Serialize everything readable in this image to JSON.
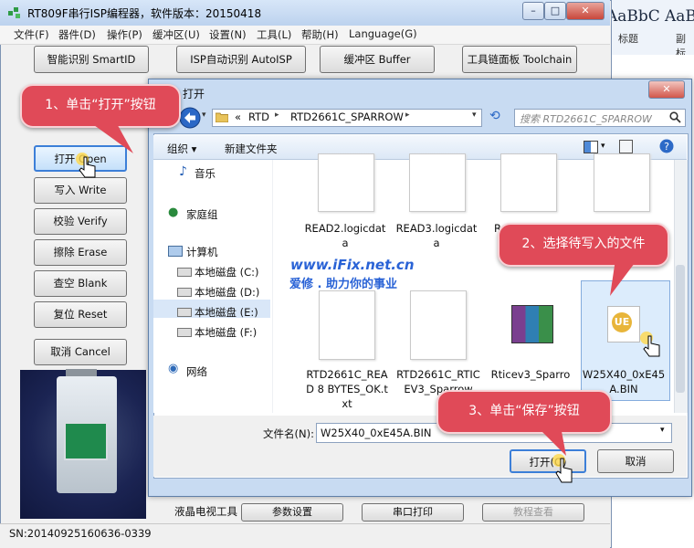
{
  "word": {
    "style1": "AaBbC",
    "style2": "AaBb",
    "cap1": "标题",
    "cap2": "副标"
  },
  "window": {
    "title": "RT809F串行ISP编程器，软件版本：20150418",
    "menu": [
      "文件(F)",
      "器件(D)",
      "操作(P)",
      "缓冲区(U)",
      "设置(N)",
      "工具(L)",
      "帮助(H)",
      "Language(G)"
    ],
    "top_buttons": [
      "智能识别 SmartID",
      "ISP自动识别 AutoISP",
      "缓冲区 Buffer",
      "工具链面板 Toolchain"
    ],
    "side_buttons": [
      "打开 Open",
      "写入 Write",
      "校验 Verify",
      "擦除 Erase",
      "查空 Blank",
      "复位 Reset",
      "取消 Cancel"
    ],
    "bottom_tools": {
      "label": "液晶电视工具",
      "buttons": [
        "参数设置",
        "串口打印",
        "教程查看"
      ]
    },
    "status": "SN:20140925160636-0339"
  },
  "dialog": {
    "title": "打开",
    "address": {
      "prefix": "«",
      "crumbs": [
        "RTD",
        "RTD2661C_SPARROW"
      ]
    },
    "search_placeholder": "搜索 RTD2661C_SPARROW",
    "toolbar": {
      "organize": "组织 ▾",
      "new_folder": "新建文件夹"
    },
    "nav": [
      {
        "label": "音乐",
        "icon": "music-icon"
      },
      {
        "label": "家庭组",
        "icon": "homegroup-icon"
      },
      {
        "label": "计算机",
        "icon": "computer-icon"
      },
      {
        "label": "本地磁盘 (C:)",
        "icon": "drive-icon"
      },
      {
        "label": "本地磁盘 (D:)",
        "icon": "drive-icon"
      },
      {
        "label": "本地磁盘 (E:)",
        "icon": "drive-icon"
      },
      {
        "label": "本地磁盘 (F:)",
        "icon": "drive-icon"
      },
      {
        "label": "网络",
        "icon": "network-icon"
      }
    ],
    "files_row1": [
      "READ2.logicdata",
      "READ3.logicdata",
      "R"
    ],
    "files_row2": [
      "RTD2661C_READ 8 BYTES_OK.txt",
      "RTD2661C_RTICEV3_Sparrow",
      "Rticev3_Sparro",
      "W25X40_0xE45A.BIN"
    ],
    "filename_label": "文件名(N):",
    "filename_value": "W25X40_0xE45A.BIN",
    "open_button": "打开(O)",
    "cancel_button": "取消"
  },
  "watermark": {
    "line1": "www.iFix.net.cn",
    "line2": "爱修 . 助力你的事业"
  },
  "callouts": [
    "1、单击“打开”按钮",
    "2、选择待写入的文件",
    "3、单击“保存”按钮"
  ]
}
